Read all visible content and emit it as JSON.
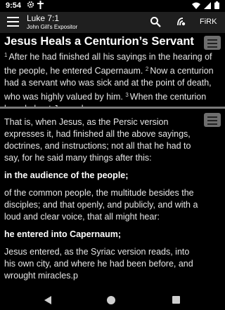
{
  "status_bar": {
    "time": "9:54",
    "left_icons": [
      "settings-gear-icon",
      "cross-icon"
    ],
    "right_icons": [
      "wifi-icon",
      "signal-icon",
      "battery-icon"
    ]
  },
  "app_bar": {
    "title": "Luke 7:1",
    "subtitle": "John Gill's Expositor",
    "firk_label": "FiRK"
  },
  "scripture_pane": {
    "heading": "Jesus Heals a Centurion’s Servant",
    "verses": [
      {
        "num": "1",
        "text": "After he had finished all his sayings in the hearing of the people, he entered Capernaum."
      },
      {
        "num": "2",
        "text": "Now a centurion had a servant who was sick and at the point of death, who was highly valued by him."
      },
      {
        "num": "3",
        "text": "When the centurion heard about Jesus, he"
      }
    ]
  },
  "commentary_pane": {
    "paragraphs": [
      {
        "text": "That is, when Jesus, as the Persic version expresses it, had finished all the above sayings, doctrines, and instructions; not all that he had to say, for he said many things after this:",
        "bold": false
      },
      {
        "text": "in the audience of the people;",
        "bold": true
      },
      {
        "text": "of the common people, the multitude besides the disciples; and that openly, and publicly, and with a loud and clear voice, that all might hear:",
        "bold": false
      },
      {
        "text": "he entered into Capernaum;",
        "bold": true
      },
      {
        "text": "Jesus entered, as the Syriac version reads, into his own city, and where he had been before, and wrought miracles.p",
        "bold": false
      }
    ]
  },
  "colors": {
    "background": "#000000",
    "app_bar": "#1f1f1f",
    "divider": "#7a7a7a",
    "text": "#e6e6e6",
    "menu_button": "#6e6e6e"
  }
}
